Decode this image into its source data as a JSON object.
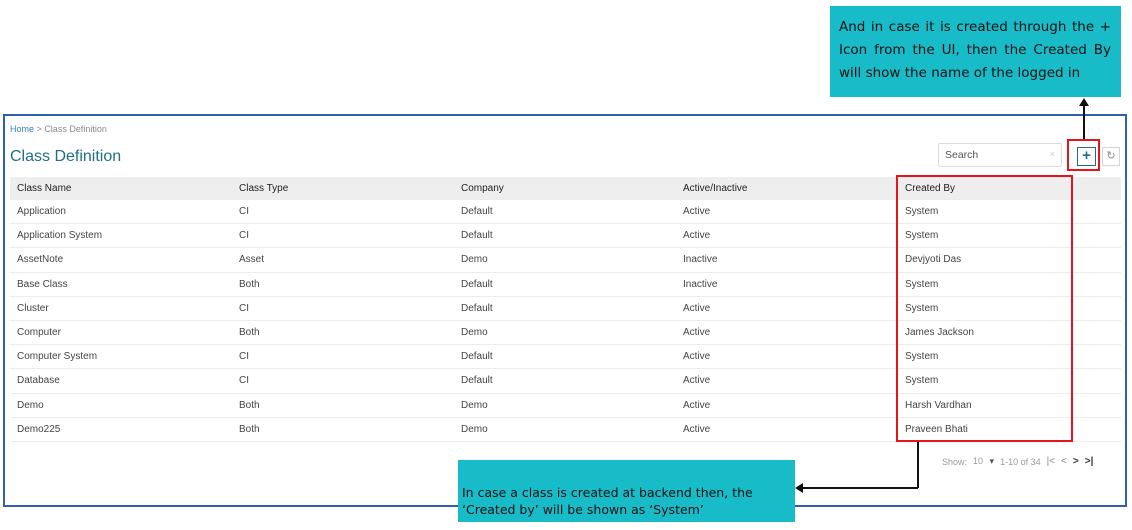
{
  "callouts": {
    "top": "And in case it is created through the + Icon from the UI, then the Created By will show the name of the logged in",
    "bottom": "In case a class is created at backend then, the ‘Created by’ will be shown as ‘System’"
  },
  "breadcrumb": {
    "home": "Home",
    "separator": ">",
    "current": "Class Definition"
  },
  "page_title": "Class Definition",
  "search": {
    "placeholder": "Search",
    "clear_icon": "×"
  },
  "toolbar": {
    "add_icon": "+",
    "refresh_icon": "↻"
  },
  "table": {
    "columns": [
      "Class Name",
      "Class Type",
      "Company",
      "Active/Inactive",
      "Created By"
    ],
    "rows": [
      [
        "Application",
        "CI",
        "Default",
        "Active",
        "System"
      ],
      [
        "Application System",
        "CI",
        "Default",
        "Active",
        "System"
      ],
      [
        "AssetNote",
        "Asset",
        "Demo",
        "Inactive",
        "Devjyoti Das"
      ],
      [
        "Base Class",
        "Both",
        "Default",
        "Inactive",
        "System"
      ],
      [
        "Cluster",
        "CI",
        "Default",
        "Active",
        "System"
      ],
      [
        "Computer",
        "Both",
        "Demo",
        "Active",
        "James Jackson"
      ],
      [
        "Computer System",
        "CI",
        "Default",
        "Active",
        "System"
      ],
      [
        "Database",
        "CI",
        "Default",
        "Active",
        "System"
      ],
      [
        "Demo",
        "Both",
        "Demo",
        "Active",
        "Harsh Vardhan"
      ],
      [
        "Demo225",
        "Both",
        "Demo",
        "Active",
        "Praveen Bhati"
      ]
    ]
  },
  "pagination": {
    "show_label": "Show:",
    "page_size": "10",
    "dropdown_icon": "▾",
    "range": "1-10 of 34",
    "first": "|<",
    "prev": "<",
    "next": ">",
    "last": ">|"
  },
  "colors": {
    "callout": "#18bcc8",
    "highlight": "#e8141c",
    "frame": "#2f5fb0",
    "title": "#1f6f86"
  }
}
